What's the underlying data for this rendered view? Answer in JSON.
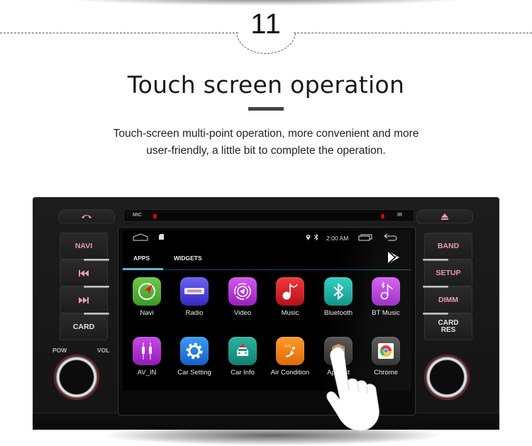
{
  "step": {
    "number": "11"
  },
  "heading": {
    "title": "Touch screen operation",
    "subtitle_line1": "Touch-screen multi-point operation, more convenient and more",
    "subtitle_line2": "user-friendly, a little bit to complete the operation."
  },
  "head_unit": {
    "top_labels": {
      "mic": "MIC",
      "ir": "IR"
    },
    "top_buttons": [
      {
        "name": "call",
        "icon": "phone-hangup-icon",
        "glyph": "☎"
      },
      {
        "name": "eject",
        "icon": "eject-icon",
        "glyph": "▲"
      }
    ],
    "left_buttons": [
      {
        "label": "NAVI"
      },
      {
        "label": "⏮",
        "icon": "previous-track-icon"
      },
      {
        "label": "⏭",
        "icon": "next-track-icon"
      },
      {
        "label": "CARD"
      }
    ],
    "right_buttons": [
      {
        "label": "BAND"
      },
      {
        "label": "SETUP"
      },
      {
        "label": "DIMM"
      },
      {
        "label": "CARD\nRES",
        "line1": "CARD",
        "line2": "RES"
      }
    ],
    "knob_labels": {
      "pow": "POW",
      "vol": "VOL"
    }
  },
  "screen": {
    "statusbar": {
      "home_icon": "home-icon",
      "sd_icon": "sd-card-icon",
      "location_icon": "location-icon",
      "bluetooth_icon": "bluetooth-icon",
      "time": "2:00 AM",
      "recents_icon": "recent-apps-icon",
      "back_icon": "back-icon"
    },
    "tabs": [
      {
        "label": "APPS",
        "active": true
      },
      {
        "label": "WIDGETS",
        "active": false
      }
    ],
    "store_icon": "play-store-icon",
    "accent_color": "#5bb7d8",
    "apps": [
      {
        "label": "Navi",
        "icon": "navigation-icon",
        "color": "#4caf34"
      },
      {
        "label": "Radio",
        "icon": "radio-icon",
        "color": "#4a3fd6"
      },
      {
        "label": "Video",
        "icon": "video-icon",
        "color": "#b42bd6"
      },
      {
        "label": "Music",
        "icon": "music-icon",
        "color": "#d8202a"
      },
      {
        "label": "Bluetooth",
        "icon": "bluetooth-icon",
        "color": "#18b3a6"
      },
      {
        "label": "BT Music",
        "icon": "bt-music-icon",
        "color": "#b83ad8"
      },
      {
        "label": "AV_IN",
        "icon": "av-in-icon",
        "color": "#b32fd0"
      },
      {
        "label": "Car Setting",
        "icon": "gear-icon",
        "color": "#1e7fe0"
      },
      {
        "label": "Car Info",
        "icon": "car-info-icon",
        "color": "#1a9a8a"
      },
      {
        "label": "Air Condition",
        "icon": "air-condition-icon",
        "color": "#f07f12"
      },
      {
        "label": "ApkInst",
        "icon": "apk-installer-icon",
        "color": "#3a3a3a"
      },
      {
        "label": "Chrome",
        "icon": "chrome-icon",
        "color": "#3a3a3a"
      }
    ]
  }
}
